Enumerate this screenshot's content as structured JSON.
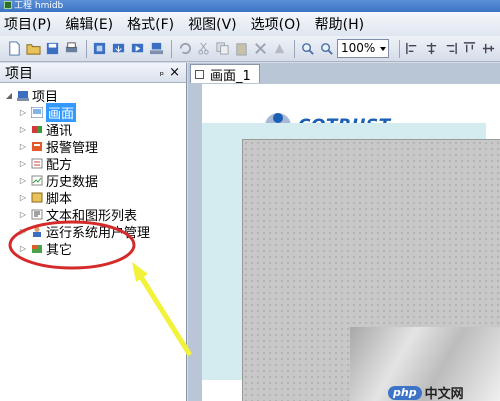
{
  "window": {
    "title": "工程 hmidb"
  },
  "menubar": {
    "items": [
      "项目(P)",
      "编辑(E)",
      "格式(F)",
      "视图(V)",
      "选项(O)",
      "帮助(H)"
    ]
  },
  "toolbar": {
    "zoom": "100%"
  },
  "panel": {
    "title": "项目",
    "pin": "ₚ",
    "close": "×",
    "root": "项目",
    "items": [
      {
        "label": "画面",
        "icon": "screen-icon",
        "selected": true
      },
      {
        "label": "通讯",
        "icon": "comm-icon"
      },
      {
        "label": "报警管理",
        "icon": "alarm-icon"
      },
      {
        "label": "配方",
        "icon": "recipe-icon"
      },
      {
        "label": "历史数据",
        "icon": "history-icon"
      },
      {
        "label": "脚本",
        "icon": "script-icon"
      },
      {
        "label": "文本和图形列表",
        "icon": "textlist-icon"
      },
      {
        "label": "运行系统用户管理",
        "icon": "user-icon"
      },
      {
        "label": "其它",
        "icon": "other-icon"
      }
    ]
  },
  "editor": {
    "tab": "画面_1",
    "logo_text": "COTRUST"
  },
  "watermark": {
    "badge": "php",
    "text": "中文网"
  },
  "colors": {
    "selection": "#3399ff",
    "logo": "#1a5fb4",
    "annotation_circle": "#d42a2a",
    "annotation_arrow": "#f2f23a"
  }
}
